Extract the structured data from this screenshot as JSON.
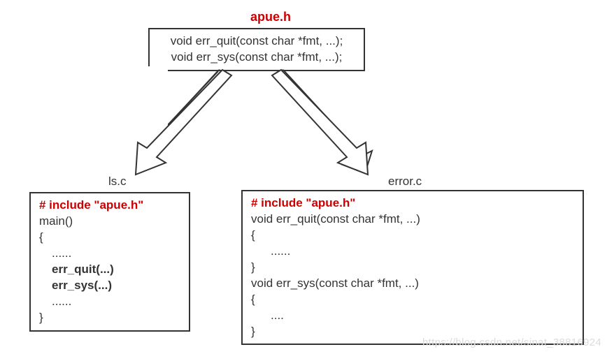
{
  "header": {
    "title": "apue.h",
    "line1": "void err_quit(const char *fmt, ...);",
    "line2": "void err_sys(const char *fmt, ...);"
  },
  "left": {
    "filename": "ls.c",
    "include": "# include \"apue.h\"",
    "l1": "main()",
    "l2": "{",
    "l3": "......",
    "l4": "err_quit(...)",
    "l5": "err_sys(...)",
    "l6": "......",
    "l7": "}"
  },
  "right": {
    "filename": "error.c",
    "include": "# include \"apue.h\"",
    "l1": "void err_quit(const char *fmt, ...)",
    "l2": "{",
    "l3": "......",
    "l4": "}",
    "l5": "void err_sys(const char *fmt, ...)",
    "l6": "{",
    "l7": "....",
    "l8": "}"
  },
  "watermark": "https://blog.csdn.net/sinat_38816924"
}
